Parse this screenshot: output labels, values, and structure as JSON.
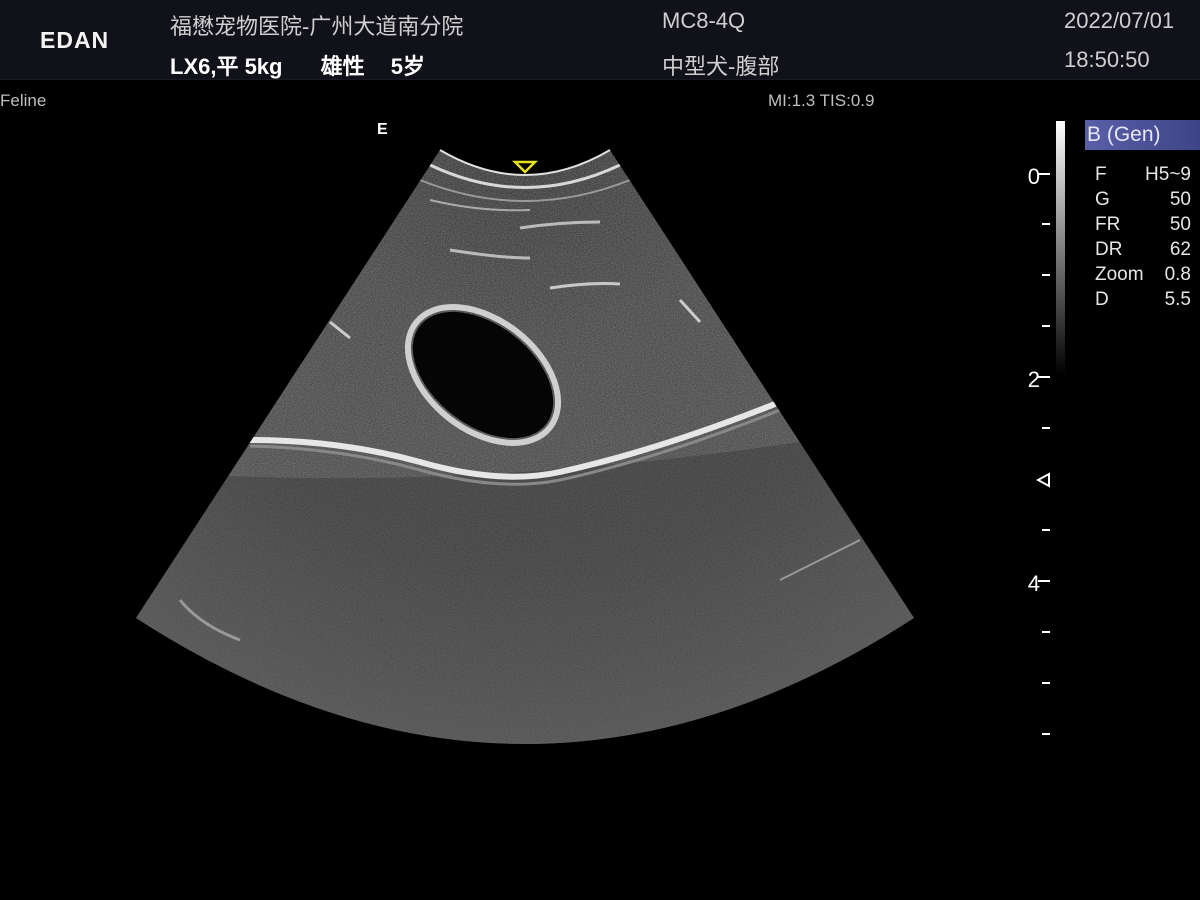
{
  "header": {
    "logo": "EDAN",
    "hospital": "福懋宠物医院-广州大道南分院",
    "patient": {
      "id_weight": "LX6,平 5kg",
      "gender": "雄性",
      "age": "5岁"
    },
    "probe": "MC8-4Q",
    "preset": "中型犬-腹部",
    "date": "2022/07/01",
    "time": "18:50:50"
  },
  "info": {
    "species": "Feline",
    "mi_tis": "MI:1.3 TIS:0.9",
    "orientation_mark": "E"
  },
  "depth_scale": {
    "labels": [
      "0",
      "2",
      "4"
    ]
  },
  "mode": {
    "label": "B (Gen)",
    "params": [
      {
        "key": "F",
        "value": "H5~9"
      },
      {
        "key": "G",
        "value": "50"
      },
      {
        "key": "FR",
        "value": "50"
      },
      {
        "key": "DR",
        "value": "62"
      },
      {
        "key": "Zoom",
        "value": "0.8"
      },
      {
        "key": "D",
        "value": "5.5"
      }
    ]
  },
  "colors": {
    "header_bg": "#11111a",
    "mode_highlight": "#4a4f97",
    "top_marker": "#e8e020"
  },
  "icons": {
    "top_marker": "triangle-down-icon",
    "focus_marker": "triangle-left-icon"
  }
}
